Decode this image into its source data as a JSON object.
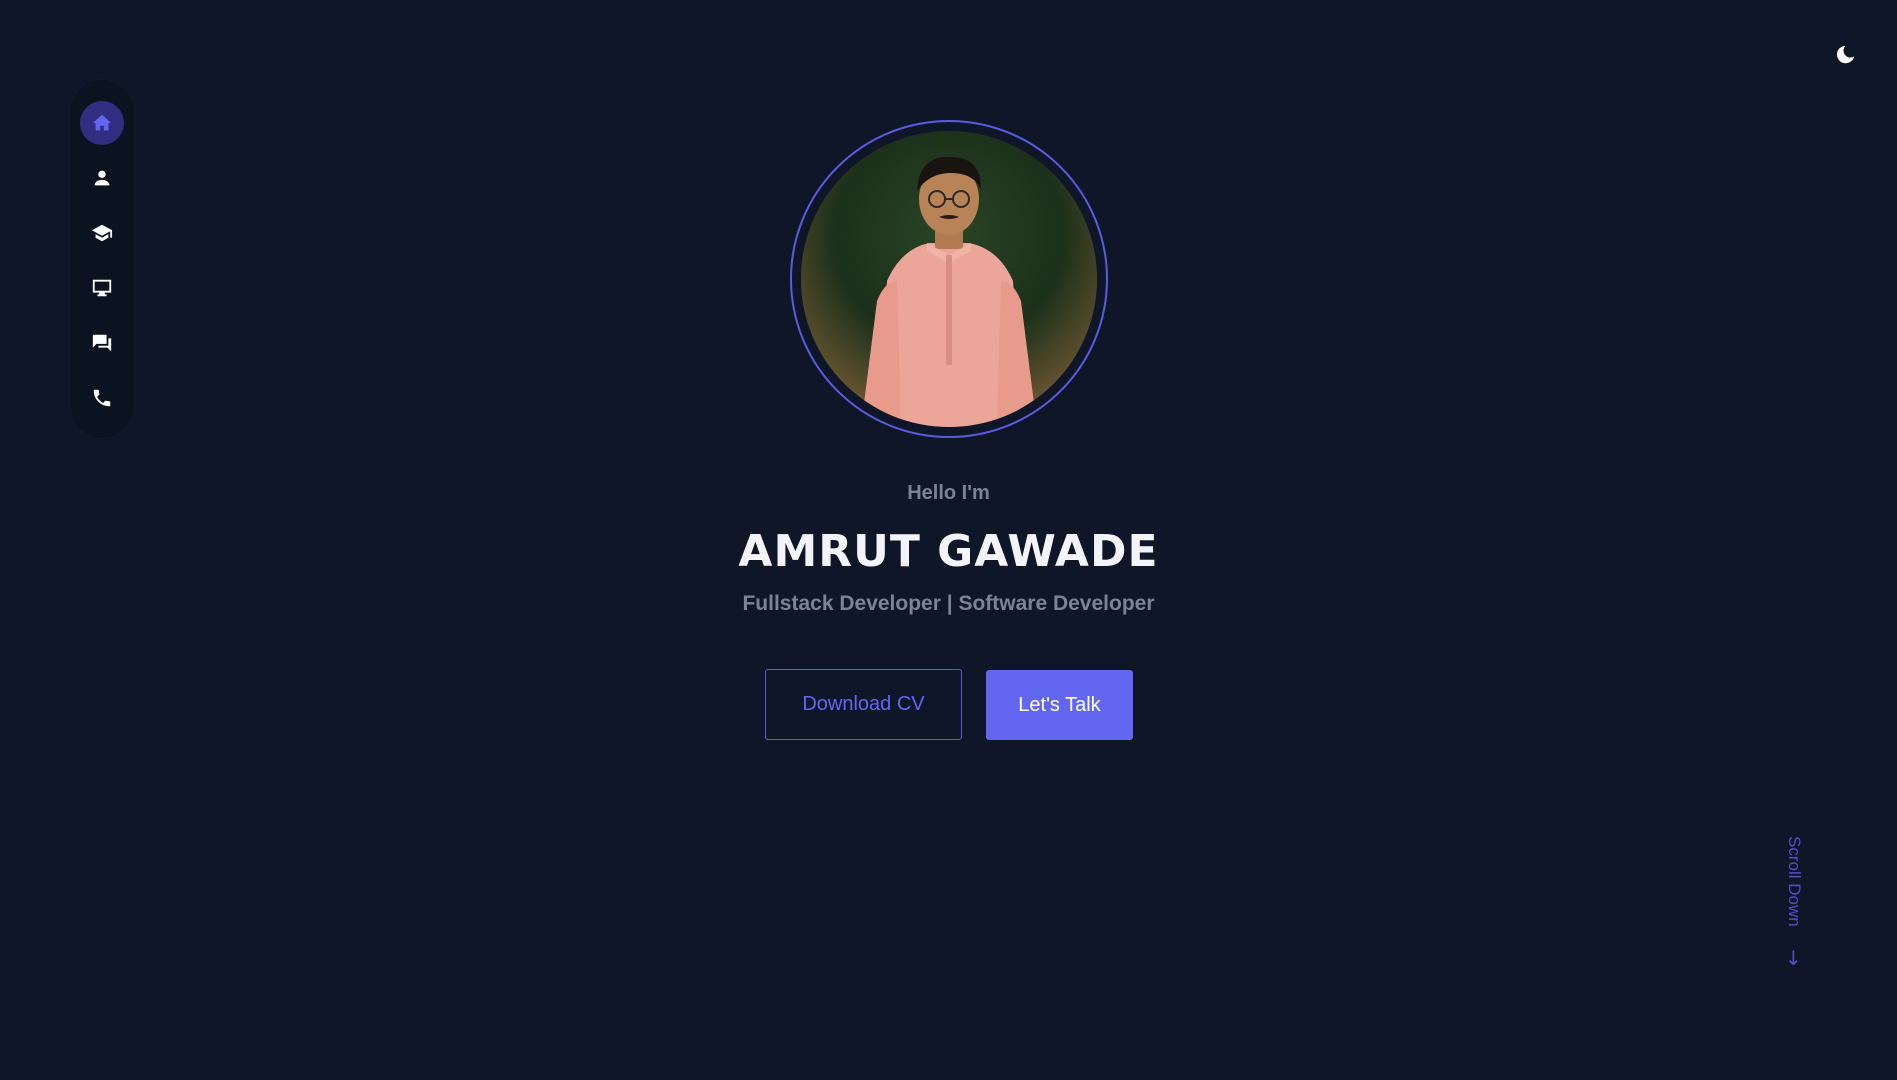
{
  "nav": {
    "items": [
      {
        "icon": "home-icon",
        "active": true
      },
      {
        "icon": "user-icon",
        "active": false
      },
      {
        "icon": "graduation-cap-icon",
        "active": false
      },
      {
        "icon": "monitor-icon",
        "active": false
      },
      {
        "icon": "chat-icon",
        "active": false
      },
      {
        "icon": "phone-icon",
        "active": false
      }
    ]
  },
  "theme_toggle": {
    "icon": "moon-icon"
  },
  "hero": {
    "greeting": "Hello I'm",
    "name": "AMRUT GAWADE",
    "role": "Fullstack Developer | Software Developer",
    "download_cv_label": "Download CV",
    "lets_talk_label": "Let's Talk"
  },
  "scroll": {
    "label": "Scroll Down",
    "arrow": "→"
  },
  "colors": {
    "background": "#0e1628",
    "accent": "#6366f1",
    "muted_text": "#7b8396",
    "sidebar": "#0b1220"
  }
}
